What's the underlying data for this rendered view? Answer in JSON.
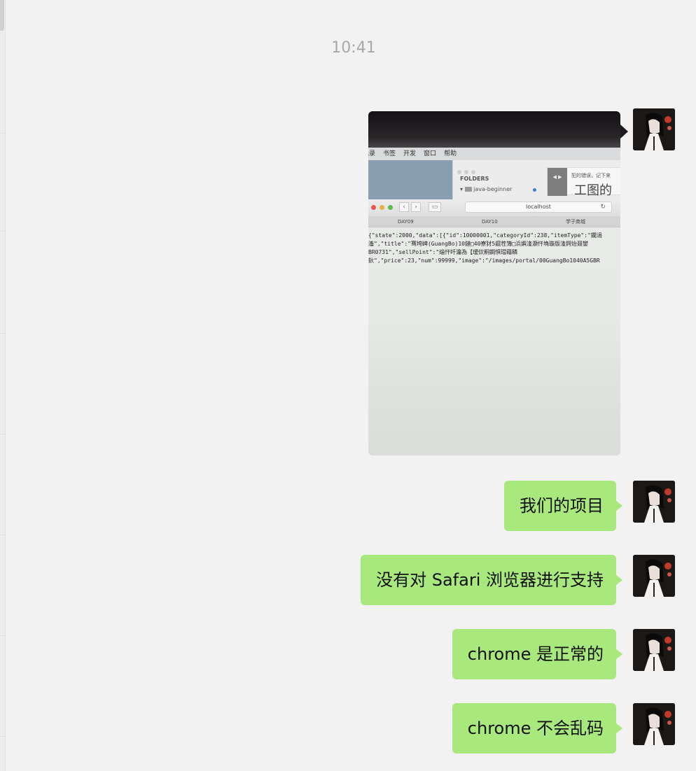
{
  "timestamp": "10:41",
  "photo": {
    "menubar": [
      "记录",
      "书签",
      "开发",
      "窗口",
      "帮助"
    ],
    "folders_label": "FOLDERS",
    "folder_item": "java-beginner",
    "note_nav": "◀ ▶",
    "note_text": "犯的错误，记下来",
    "note_big": "工图的",
    "address": "localhost",
    "reload": "↻",
    "nav_back": "‹",
    "nav_forward": "›",
    "tabs": [
      "DAY09",
      "DAY10",
      "学子商城"
    ],
    "code_lines": [
      "{\"state\":2000,\"data\":[{\"id\":10000001,\"categoryId\":238,\"itemType\":\"鐗涓",
      "滀\",\"title\":\"骞垮崥(GuangBo)10鏈□40寮犲5鑹茬簿□浜嬩湰灏忓埆璇版湰鍔炲叕鐢",
      "BR0731\",\"sellPoint\":\"缁忓吀瀹為【瑷佽粡鐧惧瑁藉疄",
      "鈥\",\"price\":23,\"num\":99999,\"image\":\"/images/portal/00GuangBo1040A5GBR"
    ]
  },
  "messages": [
    {
      "text": "我们的项目"
    },
    {
      "text": "没有对 Safari 浏览器进行支持"
    },
    {
      "text": "chrome 是正常的"
    },
    {
      "text": "chrome 不会乱码"
    }
  ],
  "colors": {
    "bubble": "#a9e87c",
    "background": "#f2f2f2",
    "timestamp": "#a8a8a8"
  },
  "icons": {
    "avatar": "avatar-anime-girl-icon"
  }
}
